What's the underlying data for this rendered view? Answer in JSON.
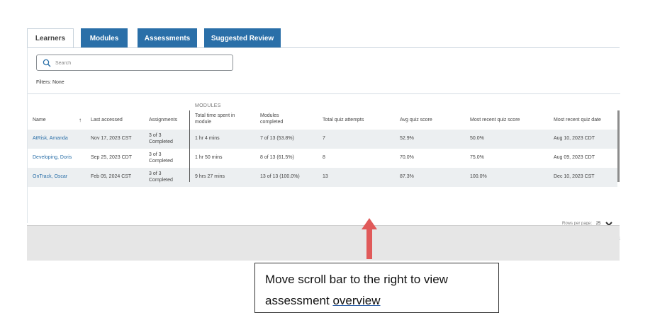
{
  "tabs": [
    "Learners",
    "Modules",
    "Assessments",
    "Suggested Review"
  ],
  "search": {
    "placeholder": "Search"
  },
  "filters_text": "Filters: None",
  "group_label": "MODULES",
  "columns": {
    "name": "Name",
    "last_accessed": "Last accessed",
    "assignments": "Assignments",
    "total_time": "Total time spent in module",
    "modules_completed": "Modules completed",
    "total_quiz_attempts": "Total quiz attempts",
    "avg_quiz_score": "Avg quiz score",
    "most_recent_quiz_score": "Most recent quiz score",
    "most_recent_quiz_date": "Most recent quiz date"
  },
  "rows": [
    {
      "name": "AtRisk, Amanda",
      "last_accessed": "Nov 17, 2023 CST",
      "assignments": "3 of 3 Completed",
      "total_time": "1 hr 4 mins",
      "modules_completed": "7 of 13 (53.8%)",
      "total_quiz_attempts": "7",
      "avg_quiz_score": "52.9%",
      "most_recent_quiz_score": "50.0%",
      "most_recent_quiz_date": "Aug 10, 2023 CDT"
    },
    {
      "name": "Developing, Doris",
      "last_accessed": "Sep 25, 2023 CDT",
      "assignments": "3 of 3 Completed",
      "total_time": "1 hr 50 mins",
      "modules_completed": "8 of 13 (61.5%)",
      "total_quiz_attempts": "8",
      "avg_quiz_score": "70.0%",
      "most_recent_quiz_score": "75.0%",
      "most_recent_quiz_date": "Aug 09, 2023 CDT"
    },
    {
      "name": "OnTrack, Oscar",
      "last_accessed": "Feb 05, 2024 CST",
      "assignments": "3 of 3 Completed",
      "total_time": "9 hrs 27 mins",
      "modules_completed": "13 of 13 (100.0%)",
      "total_quiz_attempts": "13",
      "avg_quiz_score": "87.3%",
      "most_recent_quiz_score": "100.0%",
      "most_recent_quiz_date": "Dec 10, 2023 CST"
    }
  ],
  "pager": {
    "label": "Rows per page:",
    "value": "25"
  },
  "icons": {
    "search": "search-icon",
    "sort": "sort-up-arrow-icon",
    "annotation": "red-up-arrow-icon"
  },
  "colors": {
    "tab_active_bg": "#2a6fa8",
    "link": "#2a6fa8",
    "arrow": "#e05a5a"
  },
  "callout": {
    "line1": "Move scroll bar to the right to view",
    "line2_text": "assessment ",
    "line2_underlined": "overview"
  }
}
